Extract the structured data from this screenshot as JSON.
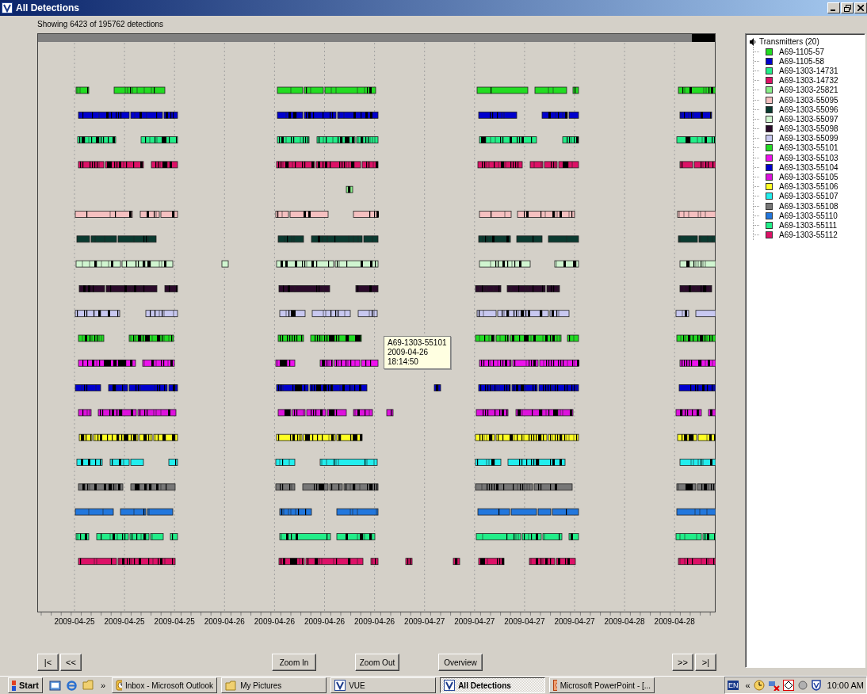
{
  "window": {
    "title": "All Detections"
  },
  "summary": "Showing 6423 of 195762 detections",
  "chart": {
    "x_labels": [
      "2009-04-25",
      "2009-04-25",
      "2009-04-25",
      "2009-04-26",
      "2009-04-26",
      "2009-04-26",
      "2009-04-26",
      "2009-04-27",
      "2009-04-27",
      "2009-04-27",
      "2009-04-27",
      "2009-04-28",
      "2009-04-28"
    ]
  },
  "tooltip": {
    "lines": [
      "A69-1303-55101",
      "2009-04-26",
      "18:14:50"
    ]
  },
  "buttons": [
    {
      "label": "|<",
      "kind": "nav"
    },
    {
      "label": "<<",
      "kind": "nav"
    },
    {
      "label": "Zoom In",
      "kind": "action"
    },
    {
      "label": "Zoom Out",
      "kind": "action"
    },
    {
      "label": "Overview",
      "kind": "action"
    },
    {
      "label": ">>",
      "kind": "nav"
    },
    {
      "label": ">|",
      "kind": "nav"
    }
  ],
  "legend": {
    "title": "Transmitters (20)",
    "items": [
      {
        "label": "A69-1105-57",
        "color": "#22dd22"
      },
      {
        "label": "A69-1105-58",
        "color": "#0000cc"
      },
      {
        "label": "A69-1303-14731",
        "color": "#22ee88"
      },
      {
        "label": "A69-1303-14732",
        "color": "#dd1166"
      },
      {
        "label": "A69-1303-25821",
        "color": "#88ee88"
      },
      {
        "label": "A69-1303-55095",
        "color": "#f5c0c0"
      },
      {
        "label": "A69-1303-55096",
        "color": "#0a3a30"
      },
      {
        "label": "A69-1303-55097",
        "color": "#d0f5d0"
      },
      {
        "label": "A69-1303-55098",
        "color": "#2a0a2a"
      },
      {
        "label": "A69-1303-55099",
        "color": "#c8c8f0"
      },
      {
        "label": "A69-1303-55101",
        "color": "#22dd23"
      },
      {
        "label": "A69-1303-55103",
        "color": "#ee11ee"
      },
      {
        "label": "A69-1303-55104",
        "color": "#0000cd"
      },
      {
        "label": "A69-1303-55105",
        "color": "#dd11dd"
      },
      {
        "label": "A69-1303-55106",
        "color": "#ffff22"
      },
      {
        "label": "A69-1303-55107",
        "color": "#22eeee"
      },
      {
        "label": "A69-1303-55108",
        "color": "#777777"
      },
      {
        "label": "A69-1303-55110",
        "color": "#2277dd"
      },
      {
        "label": "A69-1303-55111",
        "color": "#22ee89"
      },
      {
        "label": "A69-1303-55112",
        "color": "#dd1167"
      }
    ]
  },
  "taskbar": {
    "start": "Start",
    "overflow": "»",
    "tasks": [
      {
        "label": "Inbox - Microsoft Outlook",
        "kind": "clock",
        "selected": false
      },
      {
        "label": "My Pictures",
        "kind": "folder",
        "selected": false
      },
      {
        "label": "VUE",
        "kind": "vue",
        "selected": false
      },
      {
        "label": "All Detections",
        "kind": "vue",
        "selected": true
      },
      {
        "label": "Microsoft PowerPoint - [...",
        "kind": "slides",
        "selected": false
      }
    ],
    "tray": {
      "language": "EN",
      "expand": "«",
      "clock": "10:00 AM"
    }
  }
}
